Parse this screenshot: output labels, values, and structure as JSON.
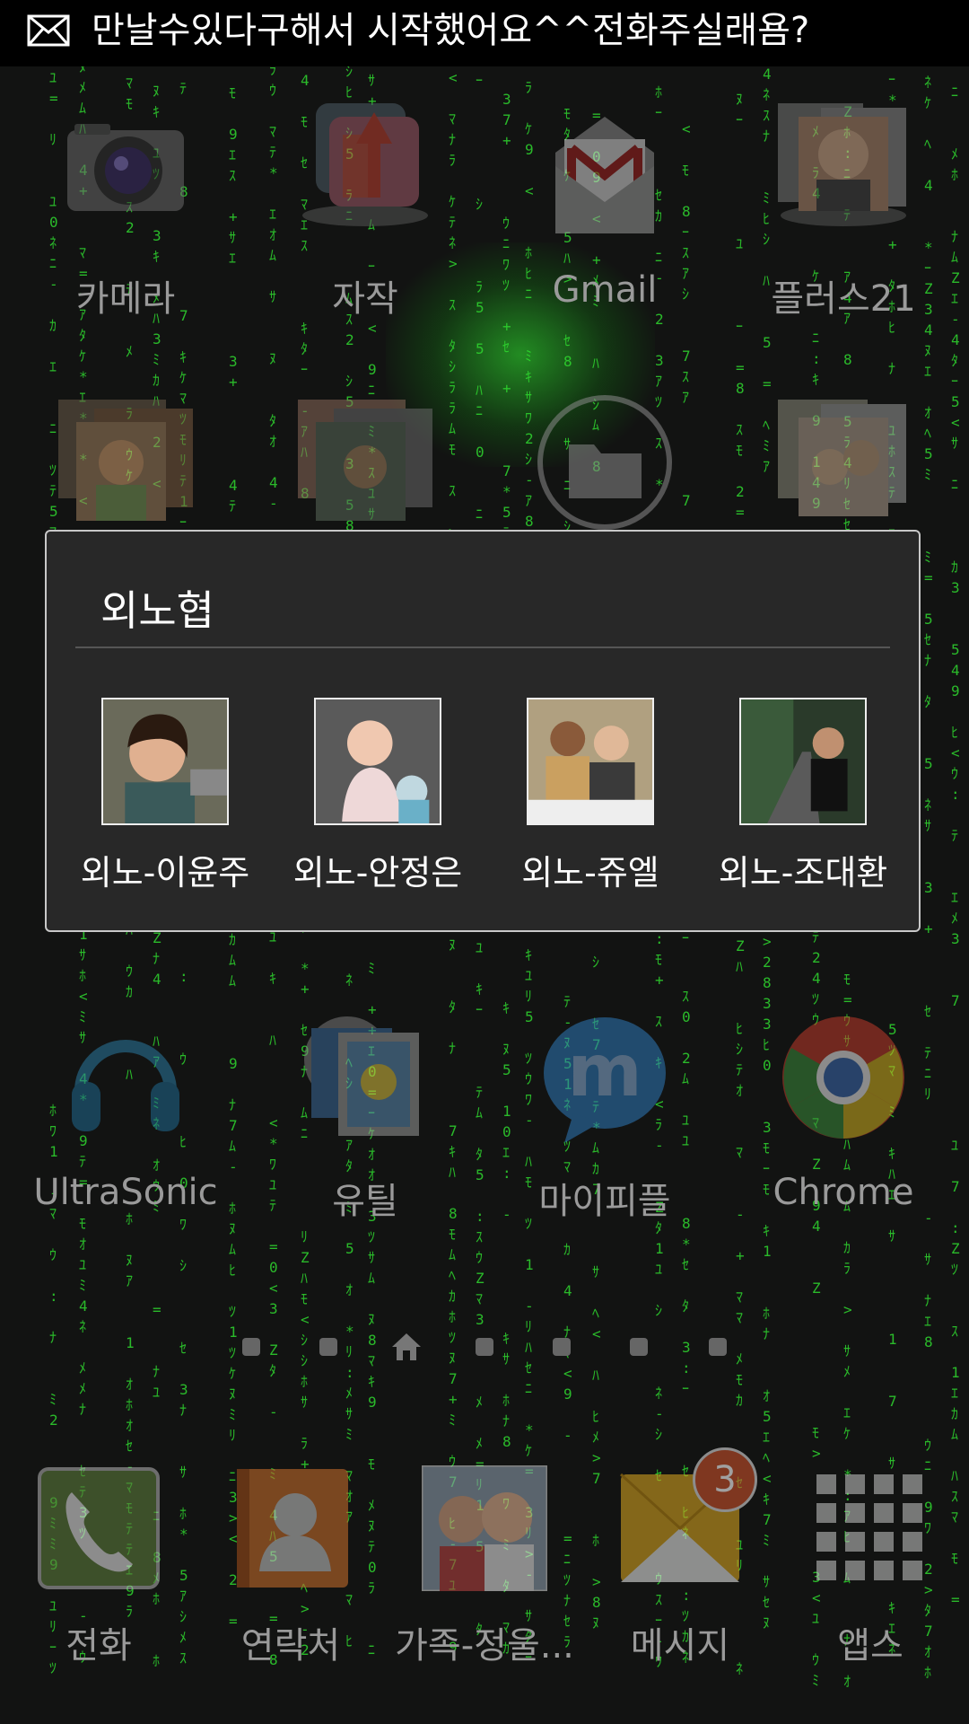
{
  "notification": {
    "icon": "envelope-icon",
    "ticker_text": "만날수있다구해서 시작했어요^^전화주실래욤?"
  },
  "apps_row1": [
    {
      "label": "카메라",
      "icon": "camera-icon"
    },
    {
      "label": "자작",
      "icon": "folder-icon"
    },
    {
      "label": "Gmail",
      "icon": "gmail-icon"
    },
    {
      "label": "플러스21",
      "icon": "folder-icon"
    }
  ],
  "apps_row3": [
    {
      "label": "UltraSonic",
      "icon": "headphones-icon"
    },
    {
      "label": "유틸",
      "icon": "folder-icon"
    },
    {
      "label": "마이피플",
      "icon": "mypeople-icon"
    },
    {
      "label": "Chrome",
      "icon": "chrome-icon"
    }
  ],
  "folder": {
    "title": "외노협",
    "contacts": [
      {
        "name": "외노-이윤주"
      },
      {
        "name": "외노-안정은"
      },
      {
        "name": "외노-쥬엘"
      },
      {
        "name": "외노-조대환"
      }
    ]
  },
  "pager": {
    "pages": 7,
    "current": 3
  },
  "dock": [
    {
      "label": "전화",
      "icon": "phone-icon"
    },
    {
      "label": "연락처",
      "icon": "contacts-icon"
    },
    {
      "label": "가족-정울...",
      "icon": "contact-photo-icon"
    },
    {
      "label": "메시지",
      "icon": "messages-icon",
      "badge": "3"
    },
    {
      "label": "앱스",
      "icon": "apps-grid-icon"
    }
  ],
  "colors": {
    "matrix_green": "#2fd82f",
    "badge": "#c8502a",
    "folder_bg": "#282828"
  }
}
